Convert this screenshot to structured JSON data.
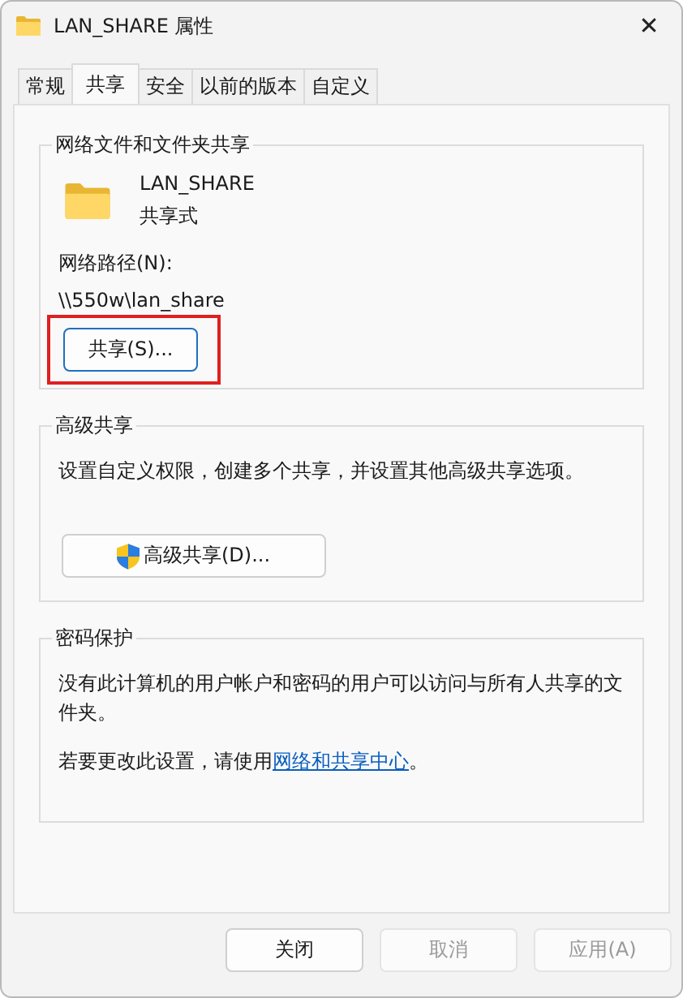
{
  "window": {
    "title": "LAN_SHARE 属性",
    "close": "✕"
  },
  "tabs": [
    {
      "label": "常规",
      "selected": false
    },
    {
      "label": "共享",
      "selected": true
    },
    {
      "label": "安全",
      "selected": false
    },
    {
      "label": "以前的版本",
      "selected": false
    },
    {
      "label": "自定义",
      "selected": false
    }
  ],
  "groups": [
    {
      "kind": "share",
      "title": "网络文件和文件夹共享",
      "name": "LAN_SHARE",
      "state": "共享式",
      "path_label": "网络路径(N):",
      "path": "\\\\550w\\lan_share",
      "button": {
        "label": "共享(S)...",
        "highlighted": true
      }
    },
    {
      "kind": "advanced",
      "title": "高级共享",
      "text": "设置自定义权限，创建多个共享，并设置其他高级共享选项。",
      "button": {
        "label": "高级共享(D)..."
      }
    },
    {
      "kind": "password",
      "title": "密码保护",
      "text": "没有此计算机的用户帐户和密码的用户可以访问与所有人共享的文件夹。",
      "note": {
        "before": "若要更改此设置，请使用",
        "link": "网络和共享中心",
        "after": "。"
      }
    }
  ],
  "buttons": [
    {
      "label": "关闭",
      "disabled": false
    },
    {
      "label": "取消",
      "disabled": true
    },
    {
      "label": "应用(A)",
      "disabled": true
    }
  ]
}
